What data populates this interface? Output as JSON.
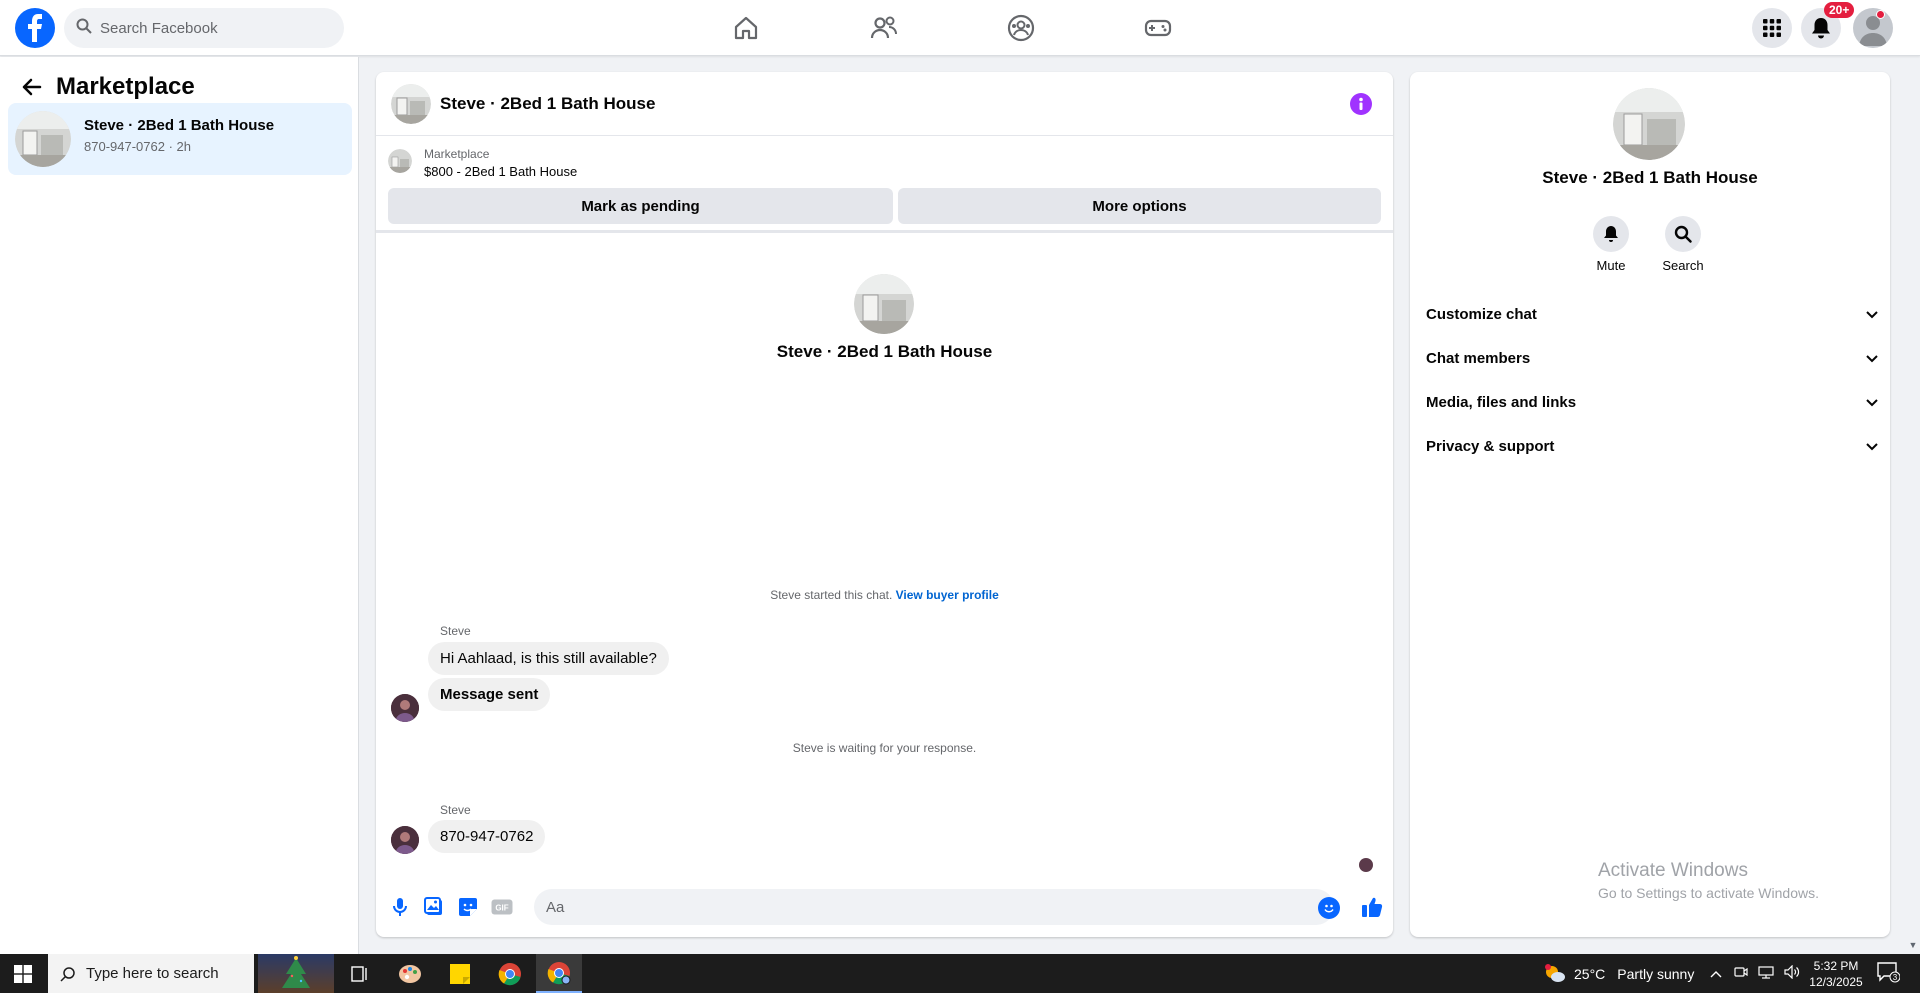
{
  "header": {
    "search_placeholder": "Search Facebook",
    "notifications_badge": "20+",
    "nav": [
      "home-icon",
      "friends-icon",
      "groups-icon",
      "gaming-icon"
    ]
  },
  "sidebar": {
    "title": "Marketplace",
    "conversations": [
      {
        "name": "Steve · 2Bed 1 Bath House",
        "subtitle": "870-947-0762 · 2h"
      }
    ]
  },
  "chat": {
    "title": "Steve · 2Bed 1 Bath House",
    "listing": {
      "label": "Marketplace",
      "price_title": "$800 - 2Bed 1 Bath House",
      "mark_pending": "Mark as pending",
      "more_options": "More options"
    },
    "profile_name": "Steve · 2Bed 1 Bath House",
    "system_started": "Steve started this chat.",
    "view_buyer_profile": "View buyer profile",
    "messages_group1": {
      "sender": "Steve",
      "msg1": "Hi Aahlaad, is this still available?",
      "msg2": "Message sent"
    },
    "system_waiting": "Steve is waiting for your response.",
    "messages_group2": {
      "sender": "Steve",
      "msg1": "870-947-0762"
    },
    "composer_placeholder": "Aa",
    "gif_label": "GIF"
  },
  "details": {
    "name": "Steve · 2Bed 1 Bath House",
    "actions": {
      "mute": "Mute",
      "search": "Search"
    },
    "sections": [
      "Customize chat",
      "Chat members",
      "Media, files and links",
      "Privacy & support"
    ],
    "watermark_title": "Activate Windows",
    "watermark_sub": "Go to Settings to activate Windows."
  },
  "taskbar": {
    "search_placeholder": "Type here to search",
    "weather_temp": "25°C",
    "weather_cond": "Partly sunny",
    "time": "5:32 PM",
    "date": "12/3/2025",
    "notif_count": "3"
  },
  "colors": {
    "brand": "#0866ff",
    "selected_bg": "#e7f3ff",
    "info_purple": "#a033ff",
    "badge_red": "#e41e3f",
    "link": "#0064d1"
  }
}
